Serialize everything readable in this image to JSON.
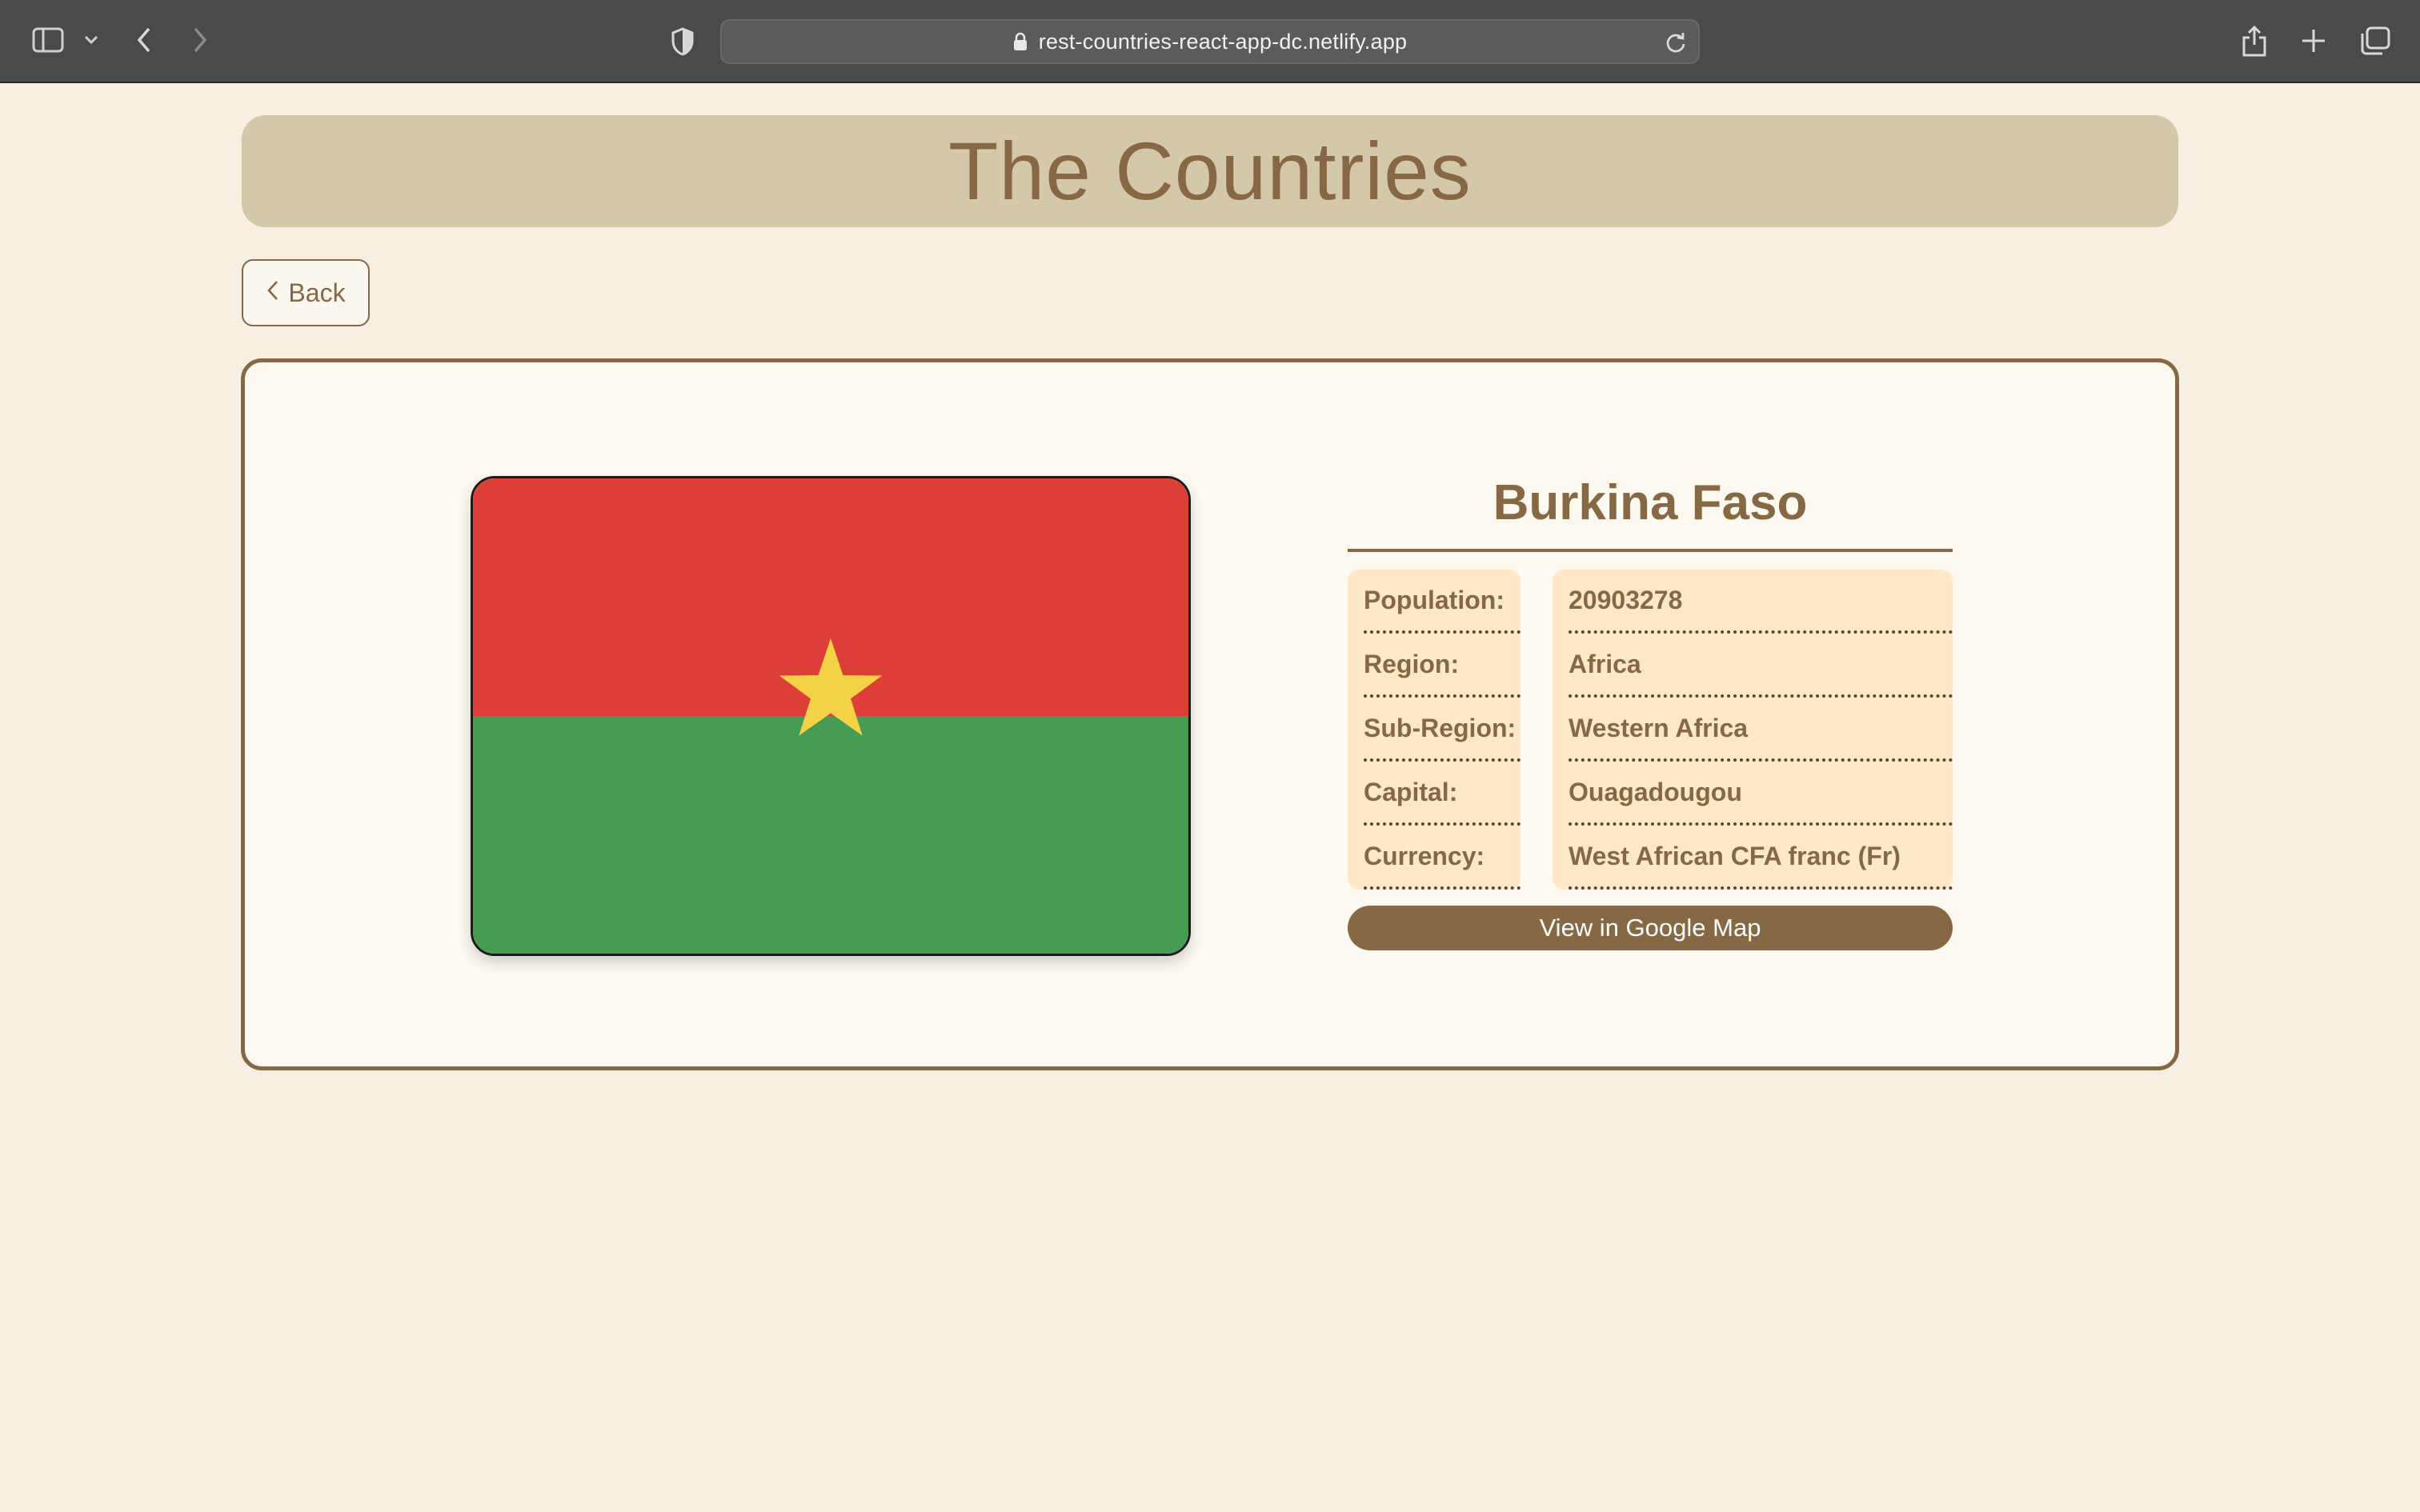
{
  "browser": {
    "url": "rest-countries-react-app-dc.netlify.app",
    "icons": [
      "sidebar-icon",
      "chevron-down-icon",
      "back-arrow-icon",
      "forward-arrow-icon",
      "shield-icon",
      "lock-icon",
      "reload-icon",
      "share-icon",
      "plus-icon",
      "tabs-icon"
    ]
  },
  "header": {
    "title": "The Countries"
  },
  "back_button": {
    "label": "Back",
    "icon": "chevron-left-icon"
  },
  "country": {
    "name": "Burkina Faso",
    "flag": {
      "icon": "burkina-faso-flag",
      "colors": {
        "top": "#dd3e38",
        "bottom": "#469c52",
        "star": "#f4d246"
      }
    },
    "fields": [
      {
        "label": "Population:",
        "value": "20903278"
      },
      {
        "label": "Region:",
        "value": "Africa"
      },
      {
        "label": "Sub-Region:",
        "value": "Western Africa"
      },
      {
        "label": "Capital:",
        "value": "Ouagadougou"
      },
      {
        "label": "Currency:",
        "value": "West African CFA franc (Fr)"
      }
    ],
    "map_button": "View in Google Map"
  },
  "colors": {
    "accent": "#876844",
    "page_bg": "#f6efe2",
    "header_bg": "#d4c8ab",
    "card_bg": "#fefaf1",
    "info_bg": "#fde8c7"
  }
}
